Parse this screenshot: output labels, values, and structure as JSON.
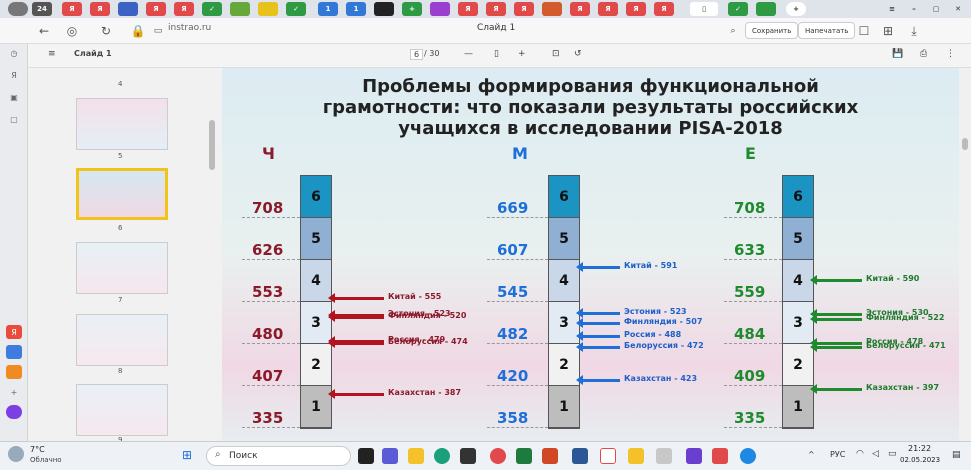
{
  "browser": {
    "tab_count": "24",
    "url": "instrao.ru",
    "page_title": "Слайд 1",
    "save_label": "Сохранить",
    "print_label": "Напечатать"
  },
  "viewer": {
    "doc_name": "Слайд 1",
    "page_current": "6",
    "page_total": "/ 30",
    "minus": "—",
    "plus": "+"
  },
  "thumbnails": [
    {
      "num": "4"
    },
    {
      "num": "5"
    },
    {
      "num": "6"
    },
    {
      "num": "7"
    },
    {
      "num": "8"
    },
    {
      "num": "9"
    }
  ],
  "slide": {
    "title_lines": [
      "Проблемы формирования функциональной",
      "грамотности: что показали результаты российских",
      "учащихся в исследовании PISA-2018"
    ],
    "columns": [
      {
        "head": "Ч",
        "color": "#8b1a2b",
        "scores": [
          "708",
          "626",
          "553",
          "480",
          "407",
          "335"
        ],
        "countries": [
          {
            "label": "Китай - 555",
            "level": 553
          },
          {
            "label": "Эстония - 523",
            "level": 523
          },
          {
            "label": "Финляндия - 520",
            "level": 520
          },
          {
            "label": "Россия - 479",
            "level": 479
          },
          {
            "label": "Белоруссия - 474",
            "level": 474
          },
          {
            "label": "Казахстан - 387",
            "level": 387
          }
        ]
      },
      {
        "head": "М",
        "color": "#1e6fd8",
        "scores": [
          "669",
          "607",
          "545",
          "482",
          "420",
          "358"
        ],
        "countries": [
          {
            "label": "Китай - 591",
            "level": 591
          },
          {
            "label": "Эстония - 523",
            "level": 523
          },
          {
            "label": "Финляндия - 507",
            "level": 507
          },
          {
            "label": "Россия - 488",
            "level": 488
          },
          {
            "label": "Белоруссия - 472",
            "level": 472
          },
          {
            "label": "Казахстан - 423",
            "level": 423
          }
        ]
      },
      {
        "head": "Е",
        "color": "#1f8a2e",
        "scores": [
          "708",
          "633",
          "559",
          "484",
          "409",
          "335"
        ],
        "countries": [
          {
            "label": "Китай - 590",
            "level": 590
          },
          {
            "label": "Эстония - 530",
            "level": 530
          },
          {
            "label": "Финляндия - 522",
            "level": 522
          },
          {
            "label": "Россия - 478",
            "level": 478
          },
          {
            "label": "Белоруссия - 471",
            "level": 471
          },
          {
            "label": "Казахстан - 397",
            "level": 397
          }
        ]
      }
    ],
    "levels": [
      "6",
      "5",
      "4",
      "3",
      "2",
      "1"
    ],
    "level_colors": [
      "#1b94c4",
      "#8fb0d2",
      "#c9d7e8",
      "#e2eaf3",
      "#f1f1f1",
      "#bdbdbd"
    ]
  },
  "taskbar": {
    "weather_temp": "7°C",
    "weather_desc": "Облачно",
    "search_placeholder": "Поиск",
    "lang": "РУС",
    "time": "21:22",
    "date": "02.05.2023"
  }
}
